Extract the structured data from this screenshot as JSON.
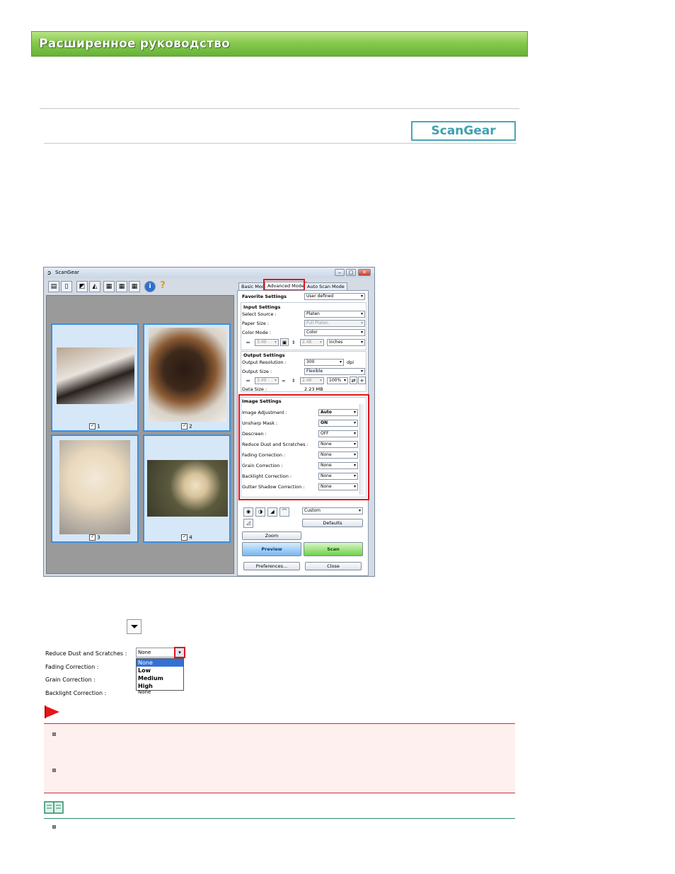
{
  "header": {
    "title": "Расширенное руководство"
  },
  "badge": {
    "label": "ScanGear"
  },
  "window": {
    "title": "ScanGear",
    "tabs": [
      "Basic Mode",
      "Advanced Mode",
      "Auto Scan Mode"
    ],
    "favorite": {
      "label": "Favorite Settings",
      "value": "User defined"
    },
    "input_settings": {
      "title": "Input Settings",
      "select_source": {
        "label": "Select Source :",
        "value": "Platen"
      },
      "paper_size": {
        "label": "Paper Size :",
        "value": "Full Platen"
      },
      "color_mode": {
        "label": "Color Mode :",
        "value": "Color"
      },
      "width": "3.49",
      "height": "2.48",
      "unit": "inches"
    },
    "output_settings": {
      "title": "Output Settings",
      "resolution": {
        "label": "Output Resolution :",
        "value": "300",
        "unit": "dpi"
      },
      "size": {
        "label": "Output Size :",
        "value": "Flexible"
      },
      "width": "3.49",
      "height": "2.48",
      "scale": "100%",
      "data_size": {
        "label": "Data Size :",
        "value": "2.23 MB"
      }
    },
    "image_settings": {
      "title": "Image Settings",
      "items": [
        {
          "label": "Image Adjustment :",
          "value": "Auto"
        },
        {
          "label": "Unsharp Mask :",
          "value": "ON"
        },
        {
          "label": "Descreen :",
          "value": "OFF"
        },
        {
          "label": "Reduce Dust and Scratches :",
          "value": "None"
        },
        {
          "label": "Fading Correction :",
          "value": "None"
        },
        {
          "label": "Grain Correction :",
          "value": "None"
        },
        {
          "label": "Backlight Correction :",
          "value": "None"
        },
        {
          "label": "Gutter Shadow Correction :",
          "value": "None"
        }
      ]
    },
    "tone_preset": "Custom",
    "defaults_label": "Defaults",
    "zoom_label": "Zoom",
    "preview_label": "Preview",
    "scan_label": "Scan",
    "preferences_label": "Preferences...",
    "close_label": "Close",
    "thumbs": [
      "1",
      "2",
      "3",
      "4"
    ]
  },
  "crop": {
    "labels": [
      "Reduce Dust and Scratches :",
      "Fading Correction :",
      "Grain Correction :",
      "Backlight Correction :"
    ],
    "current": "None",
    "options": [
      "None",
      "Low",
      "Medium",
      "High"
    ],
    "peek": "None"
  }
}
